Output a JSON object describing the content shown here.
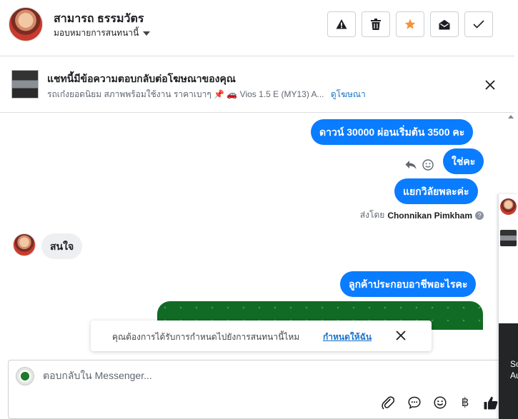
{
  "header": {
    "contact_name": "สามารถ ธรรมวัตร",
    "assign_label": "มอบหมายการสนทนานี้",
    "icons": [
      "warning-icon",
      "trash-icon",
      "star-icon",
      "envelope-open-icon",
      "check-icon"
    ],
    "star_color": "#f7923b"
  },
  "banner": {
    "title": "แชทนี้มีข้อความตอบกลับต่อโฆษณาของคุณ",
    "subtitle": "รถเก๋งยอดนิยม สภาพพร้อมใช้งาน ราคาเบาๆ 📌 🚗 Vios 1.5 E (MY13) A...",
    "link": "ดูโฆษณา"
  },
  "messages": {
    "out_1": "ดาวน์ 30000 ผ่อนเริ่มต้น 3500 คะ",
    "out_2": "ใช่คะ",
    "out_3": "แยกวิลัยพละค่ะ",
    "sent_by_prefix": "ส่งโดย",
    "sent_by_name": "Chonnikan Pimkham",
    "in_1": "สนใจ",
    "out_4": "ลูกค้าประกอบอาชีพอะไรคะ"
  },
  "prompt": {
    "text": "คุณต้องการได้รับการกำหนดไปยังการสนทนานี้ไหม",
    "link": "กำหนดให้ฉัน"
  },
  "composer": {
    "placeholder": "ตอบกลับใน Messenger...",
    "tools": [
      "attachment-icon",
      "saved-reply-icon",
      "emoji-icon",
      "baht-icon",
      "like-icon"
    ],
    "baht_glyph": "฿"
  },
  "side": {
    "text_1": "So",
    "text_2": "Au"
  },
  "colors": {
    "accent": "#0a7cff",
    "link": "#1a73c9",
    "incoming": "#eeeff1"
  }
}
